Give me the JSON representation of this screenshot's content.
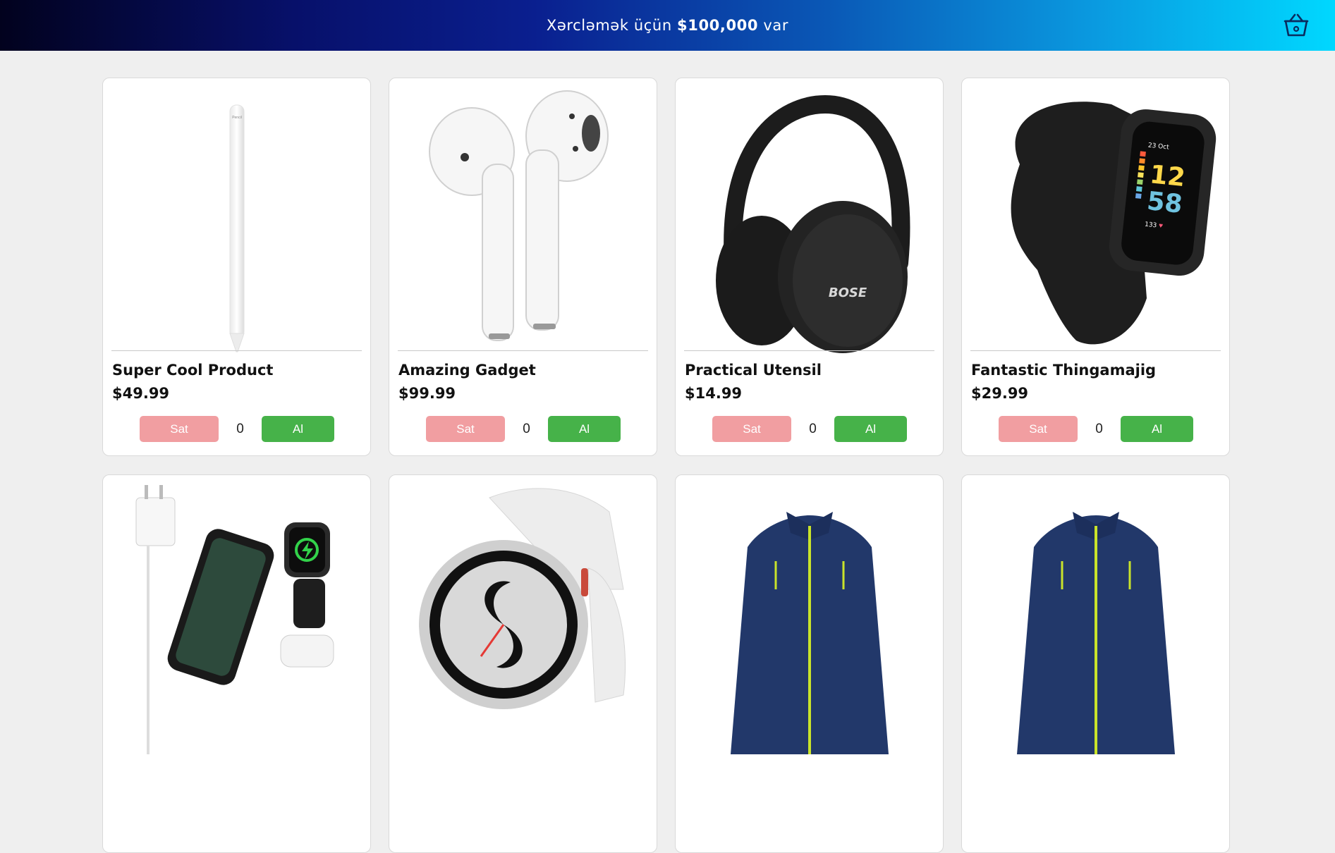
{
  "header": {
    "balance_prefix": "Xərcləmək üçün",
    "balance_amount": "$100,000",
    "balance_suffix": "var",
    "cart_icon": "basket-icon"
  },
  "colors": {
    "sell_button": "#f19ea1",
    "buy_button": "#46b249",
    "header_gradient_start": "#02021e",
    "header_gradient_end": "#00d8ff"
  },
  "products": [
    {
      "name": "Super Cool Product",
      "price": "$49.99",
      "quantity": "0",
      "sell_label": "Sat",
      "buy_label": "Al",
      "image": "stylus-pencil"
    },
    {
      "name": "Amazing Gadget",
      "price": "$99.99",
      "quantity": "0",
      "sell_label": "Sat",
      "buy_label": "Al",
      "image": "wireless-earbuds"
    },
    {
      "name": "Practical Utensil",
      "price": "$14.99",
      "quantity": "0",
      "sell_label": "Sat",
      "buy_label": "Al",
      "image": "headphones"
    },
    {
      "name": "Fantastic Thingamajig",
      "price": "$29.99",
      "quantity": "0",
      "sell_label": "Sat",
      "buy_label": "Al",
      "image": "fitness-band"
    },
    {
      "image": "charging-station"
    },
    {
      "image": "smartwatch"
    },
    {
      "image": "fleece-jacket"
    },
    {
      "image": "fleece-jacket"
    }
  ]
}
